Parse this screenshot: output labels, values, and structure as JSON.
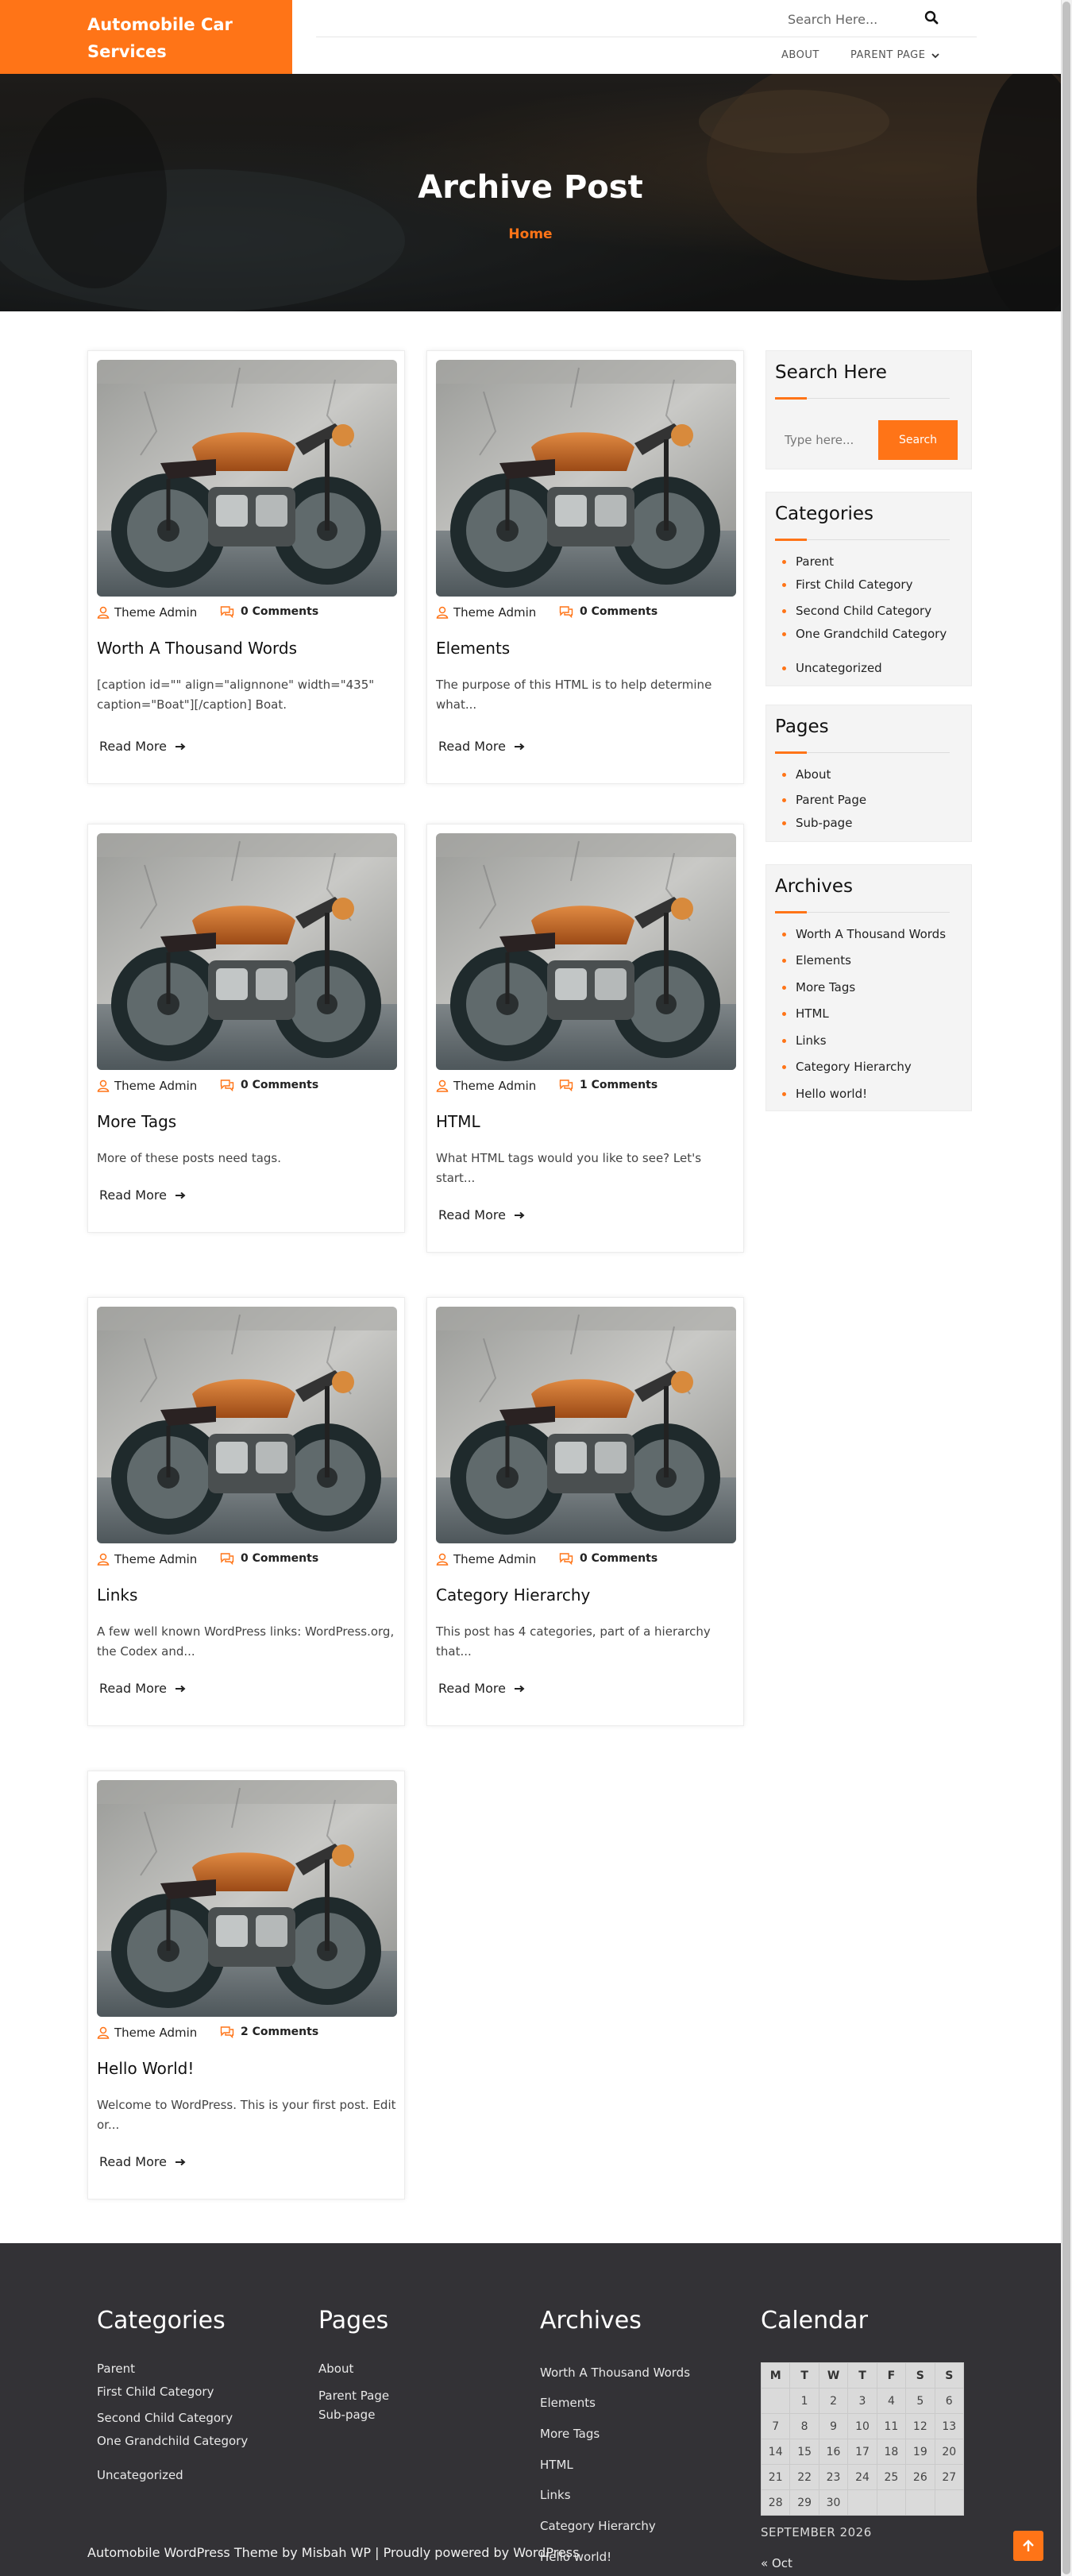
{
  "header": {
    "logo": "Automobile Car Services",
    "search_placeholder": "Search Here...",
    "nav": [
      {
        "label": "ABOUT"
      },
      {
        "label": "PARENT PAGE"
      }
    ]
  },
  "banner": {
    "title": "Archive Post",
    "breadcrumb": "Home"
  },
  "posts": [
    {
      "author": "Theme Admin",
      "comments": "0 Comments",
      "title": "Worth A Thousand Words",
      "excerpt": "[caption id=\"\" align=\"alignnone\" width=\"435\" caption=\"Boat\"][/caption] Boat.",
      "read_more": "Read More"
    },
    {
      "author": "Theme Admin",
      "comments": "0 Comments",
      "title": "Elements",
      "excerpt": "The purpose of this HTML is to help determine what...",
      "read_more": "Read More"
    },
    {
      "author": "Theme Admin",
      "comments": "0 Comments",
      "title": "More Tags",
      "excerpt": "More of these posts need tags.",
      "read_more": "Read More"
    },
    {
      "author": "Theme Admin",
      "comments": "1 Comments",
      "title": "HTML",
      "excerpt": "What HTML tags would you like to see? Let's start...",
      "read_more": "Read More"
    },
    {
      "author": "Theme Admin",
      "comments": "0 Comments",
      "title": "Links",
      "excerpt": "A few well known WordPress links: WordPress.org, the Codex and...",
      "read_more": "Read More"
    },
    {
      "author": "Theme Admin",
      "comments": "0 Comments",
      "title": "Category Hierarchy",
      "excerpt": "This post has 4 categories, part of a hierarchy that...",
      "read_more": "Read More"
    },
    {
      "author": "Theme Admin",
      "comments": "2 Comments",
      "title": "Hello World!",
      "excerpt": "Welcome to WordPress. This is your first post. Edit or...",
      "read_more": "Read More"
    }
  ],
  "sidebar": {
    "search": {
      "title": "Search Here",
      "placeholder": "Type here...",
      "button": "Search"
    },
    "categories": {
      "title": "Categories",
      "items": [
        "Parent",
        "First Child Category",
        "Second Child Category",
        "One Grandchild Category",
        "Uncategorized"
      ]
    },
    "pages": {
      "title": "Pages",
      "items": [
        "About",
        "Parent Page",
        "Sub-page"
      ]
    },
    "archives": {
      "title": "Archives",
      "items": [
        "Worth A Thousand Words",
        "Elements",
        "More Tags",
        "HTML",
        "Links",
        "Category Hierarchy",
        "Hello world!"
      ]
    }
  },
  "footer": {
    "categories": {
      "title": "Categories",
      "items": [
        "Parent",
        "First Child Category",
        "Second Child Category",
        "One Grandchild Category",
        "Uncategorized"
      ]
    },
    "pages": {
      "title": "Pages",
      "items": [
        "About",
        "Parent Page",
        "Sub-page"
      ]
    },
    "archives": {
      "title": "Archives",
      "items": [
        "Worth A Thousand Words",
        "Elements",
        "More Tags",
        "HTML",
        "Links",
        "Category Hierarchy",
        "Hello world!"
      ]
    },
    "calendar": {
      "title": "Calendar",
      "days": [
        "M",
        "T",
        "W",
        "T",
        "F",
        "S",
        "S"
      ],
      "weeks": [
        [
          "",
          "1",
          "2",
          "3",
          "4",
          "5",
          "6"
        ],
        [
          "7",
          "8",
          "9",
          "10",
          "11",
          "12",
          "13"
        ],
        [
          "14",
          "15",
          "16",
          "17",
          "18",
          "19",
          "20"
        ],
        [
          "21",
          "22",
          "23",
          "24",
          "25",
          "26",
          "27"
        ],
        [
          "28",
          "29",
          "30",
          "",
          "",
          "",
          ""
        ]
      ],
      "caption": "SEPTEMBER 2026",
      "prev": "« Oct"
    },
    "copyright": "Automobile WordPress Theme by Misbah WP | Proudly powered by WordPress"
  },
  "colors": {
    "accent": "#ff7417",
    "footer_bg": "#333236",
    "sidebar_bg": "#f4f4f4"
  }
}
